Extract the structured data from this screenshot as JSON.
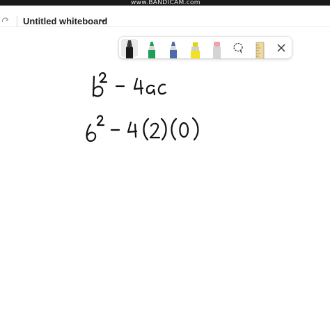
{
  "watermark": "www.BANDICAM.com",
  "header": {
    "title": "Untitled whiteboard"
  },
  "icons": {
    "redo": "redo-icon",
    "chevron": "chevron-down-icon",
    "lasso": "lasso-select-icon",
    "ruler": "ruler-icon",
    "close": "close-icon"
  },
  "toolbar": {
    "tools": [
      {
        "name": "black pen",
        "color": "#1b1b1b",
        "selected": true
      },
      {
        "name": "green pen",
        "color": "#1e9e5a",
        "selected": false
      },
      {
        "name": "blue pen",
        "color": "#4f6aa6",
        "selected": false
      },
      {
        "name": "yellow highlighter",
        "color": "#f2e21d",
        "selected": false
      },
      {
        "name": "eraser",
        "color": "#f0a1b0",
        "selected": false
      }
    ]
  },
  "canvas": {
    "ink_color": "#111111",
    "handwriting": [
      {
        "line": 1,
        "text": "b² - 4ac"
      },
      {
        "line": 2,
        "text": "6² - 4(2)(0)"
      }
    ]
  }
}
